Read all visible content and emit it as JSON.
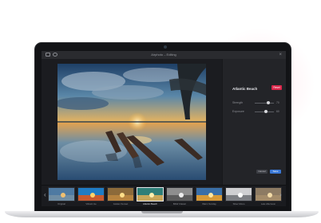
{
  "app": {
    "window_title": "Airphoto – Editing"
  },
  "panel": {
    "filter_name": "Atlantic Beach",
    "badge": "Reset",
    "sliders": [
      {
        "label": "Strength",
        "value": "70",
        "level": 0.7
      },
      {
        "label": "Exposure",
        "value": "60",
        "level": 0.6
      }
    ],
    "cancel_label": "Cancel",
    "save_label": "Save"
  },
  "filters": [
    {
      "label": "Original"
    },
    {
      "label": "Vibrant Ice"
    },
    {
      "label": "Golden Sunset"
    },
    {
      "label": "Atlantic Beach"
    },
    {
      "label": "B&W Classic"
    },
    {
      "label": "Warm Sunday"
    },
    {
      "label": "Silver Mono"
    },
    {
      "label": "Late Afternoon"
    }
  ],
  "colors": {
    "accent": "#3a78d6",
    "badge": "#d9264a",
    "selected_filter": "#e2e3e7"
  },
  "icons": [
    "sidebar-icon",
    "share-icon",
    "close-icon",
    "chevron-left-icon",
    "chevron-right-icon"
  ]
}
